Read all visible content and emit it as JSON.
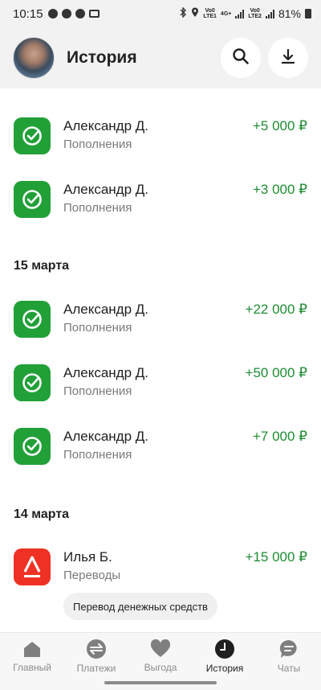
{
  "status_bar": {
    "time": "10:15",
    "battery": "81%",
    "sim1_label_top": "Vo0",
    "sim1_label_bottom": "LTE1",
    "sim1_net": "4G+",
    "sim2_label_top": "Vo0",
    "sim2_label_bottom": "LTE2"
  },
  "header": {
    "title": "История",
    "search_icon": "search-icon",
    "download_icon": "download-icon"
  },
  "transactions": [
    {
      "name": "Александр Д.",
      "category": "Пополнения",
      "amount": "+5 000 ₽",
      "bank": "sber"
    },
    {
      "name": "Александр Д.",
      "category": "Пополнения",
      "amount": "+3 000 ₽",
      "bank": "sber"
    }
  ],
  "groups": [
    {
      "date": "15 марта",
      "items": [
        {
          "name": "Александр Д.",
          "category": "Пополнения",
          "amount": "+22 000 ₽",
          "bank": "sber"
        },
        {
          "name": "Александр Д.",
          "category": "Пополнения",
          "amount": "+50 000 ₽",
          "bank": "sber"
        },
        {
          "name": "Александр Д.",
          "category": "Пополнения",
          "amount": "+7 000 ₽",
          "bank": "sber"
        }
      ]
    },
    {
      "date": "14 марта",
      "items": [
        {
          "name": "Илья Б.",
          "category": "Переводы",
          "amount": "+15 000 ₽",
          "bank": "alfa",
          "note": "Перевод денежных средств"
        }
      ]
    }
  ],
  "bottom_nav": [
    {
      "label": "Главный",
      "icon": "home-icon",
      "active": false
    },
    {
      "label": "Платежи",
      "icon": "payments-icon",
      "active": false
    },
    {
      "label": "Выгода",
      "icon": "heart-icon",
      "active": false
    },
    {
      "label": "История",
      "icon": "clock-icon",
      "active": true
    },
    {
      "label": "Чаты",
      "icon": "chat-icon",
      "active": false
    }
  ],
  "colors": {
    "accent_green": "#21a038",
    "amount_green": "#1e8c33",
    "alfa_red": "#ef3124"
  }
}
